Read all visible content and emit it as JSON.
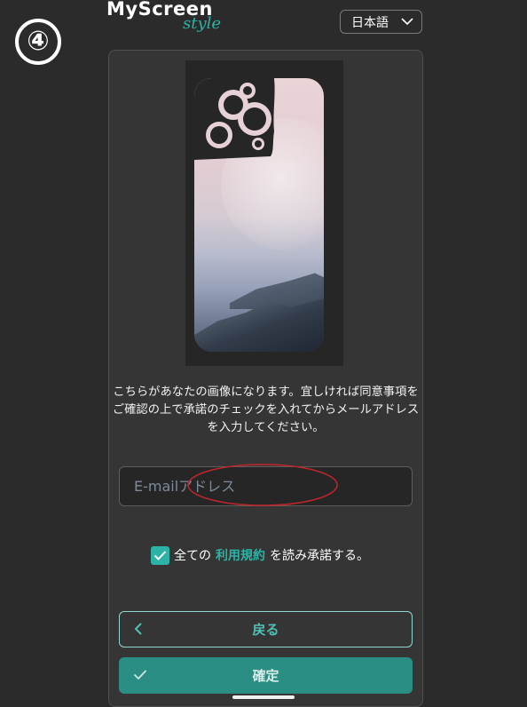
{
  "step_badge": "④",
  "brand": {
    "name": "MyScreen",
    "sub": "style"
  },
  "language": {
    "selected": "日本語",
    "icon": "chevron-down-icon"
  },
  "message": "こちらがあなたの画像になります。宜しければ同意事項をご確認の上で承諾のチェックを入れてからメールアドレスを入力してください。",
  "email": {
    "placeholder": "E-mailアドレス",
    "value": ""
  },
  "terms": {
    "checked": true,
    "prefix": "全ての",
    "link": "利用規約",
    "suffix": "を読み承諾する。"
  },
  "buttons": {
    "back_label": "戻る",
    "back_icon": "chevron-left-icon",
    "confirm_label": "確定",
    "confirm_icon": "check-icon"
  },
  "colors": {
    "background": "#2b2b2b",
    "card": "#353535",
    "accent": "#2bb3a6",
    "confirm_button": "#2a8e84",
    "annotation": "#c0262b"
  }
}
